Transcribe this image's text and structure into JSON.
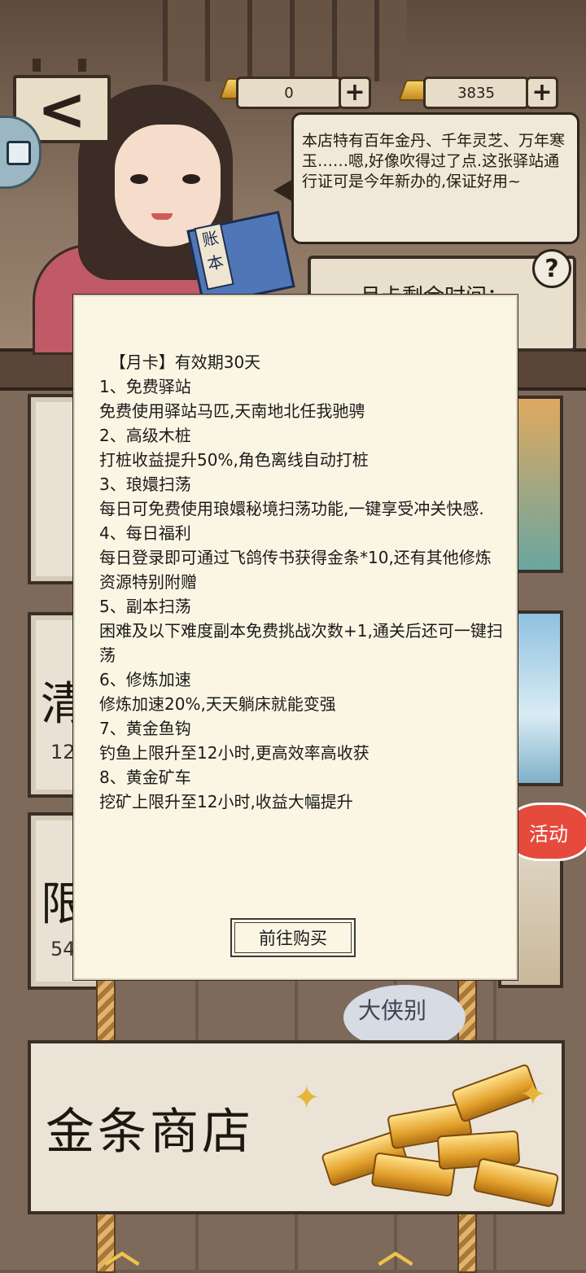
{
  "header": {
    "back_label": "<",
    "currency_1": {
      "value": "0",
      "add_label": "+"
    },
    "currency_2": {
      "value": "3835",
      "add_label": "+"
    }
  },
  "npc": {
    "speech": "本店特有百年金丹、千年灵芝、万年寒玉……嗯,好像吹得过了点.这张驿站通行证可是今年新办的,保证好用~",
    "book_title": "账本"
  },
  "month_panel": {
    "label": "月卡剩余时间：",
    "help_label": "?"
  },
  "background_boards": {
    "board_2_char": "清",
    "board_2_sub": "12",
    "board_3_char": "限",
    "board_3_sub": "54",
    "activity_badge": "活动",
    "speech_small": "大侠别"
  },
  "dialog": {
    "lines": [
      "  【月卡】有效期30天",
      "1、免费驿站",
      "免费使用驿站马匹,天南地北任我驰骋",
      "2、高级木桩",
      "打桩收益提升50%,角色离线自动打桩",
      "3、琅嬛扫荡",
      "每日可免费使用琅嬛秘境扫荡功能,一键享受冲关快感.",
      "4、每日福利",
      "每日登录即可通过飞鸽传书获得金条*10,还有其他修炼资源特别附赠",
      "5、副本扫荡",
      "困难及以下难度副本免费挑战次数+1,通关后还可一键扫荡",
      "6、修炼加速",
      "修炼加速20%,天天躺床就能变强",
      "7、黄金鱼钩",
      "钓鱼上限升至12小时,更高效率高收获",
      "8、黄金矿车",
      "挖矿上限升至12小时,收益大幅提升"
    ],
    "buy_label": "前往购买"
  },
  "gold_shop": {
    "title": "金条商店"
  },
  "colors": {
    "dialog_bg": "#fbf6e4",
    "gold": "#e7b53c",
    "wood_dark": "#3a2e25"
  }
}
